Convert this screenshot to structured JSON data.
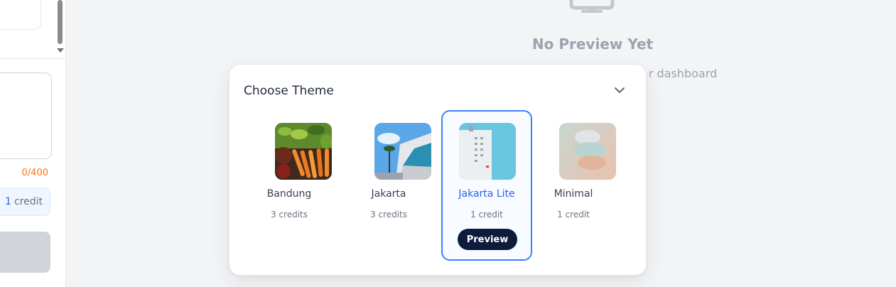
{
  "sidebar": {
    "char_count": "0/400",
    "credit_amount": "1",
    "credit_label": "credit"
  },
  "preview_area": {
    "title": "No Preview Yet",
    "subtitle_visible_fragment": "r dashboard"
  },
  "theme_picker": {
    "title": "Choose Theme",
    "selected": "Jakarta Lite",
    "themes": [
      {
        "name": "Bandung",
        "credits": "3 credits"
      },
      {
        "name": "Jakarta",
        "credits": "3 credits"
      },
      {
        "name": "Jakarta Lite",
        "credits": "1 credit",
        "preview_label": "Preview"
      },
      {
        "name": "Minimal",
        "credits": "1 credit"
      }
    ]
  },
  "colors": {
    "accent_blue": "#3b82f6",
    "selected_text": "#2563eb",
    "preview_button_bg": "#0f1b3d",
    "counter_orange": "#f97316"
  }
}
